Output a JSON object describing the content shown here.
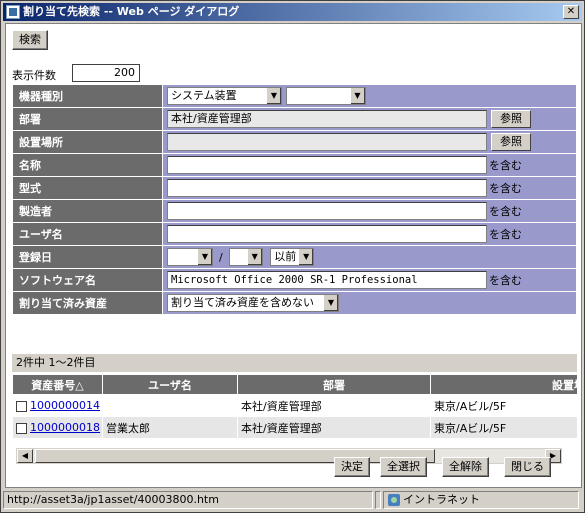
{
  "window": {
    "title": "割り当て先検索 -- Web ページ ダイアログ",
    "close": "✕"
  },
  "toolbar": {
    "search_label": "検索"
  },
  "display_count": {
    "label": "表示件数",
    "value": "200"
  },
  "form": {
    "device_type": {
      "label": "機器種別",
      "selected": "システム装置",
      "selected2": ""
    },
    "department": {
      "label": "部署",
      "value": "本社/資産管理部",
      "ref_label": "参照"
    },
    "location": {
      "label": "設置場所",
      "value": "",
      "ref_label": "参照"
    },
    "name": {
      "label": "名称",
      "value": "",
      "suffix": "を含む"
    },
    "model": {
      "label": "型式",
      "value": "",
      "suffix": "を含む"
    },
    "maker": {
      "label": "製造者",
      "value": "",
      "suffix": "を含む"
    },
    "user_name": {
      "label": "ユーザ名",
      "value": "",
      "suffix": "を含む"
    },
    "reg_date": {
      "label": "登録日",
      "year": "",
      "sep": "/",
      "month": "",
      "cond": "以前"
    },
    "software": {
      "label": "ソフトウェア名",
      "value": "Microsoft Office 2000 SR-1 Professional",
      "suffix": "を含む"
    },
    "assigned": {
      "label": "割り当て済み資産",
      "selected": "割り当て済み資産を含めない"
    }
  },
  "results": {
    "summary": "2件中 1～2件目",
    "columns": [
      "資産番号△",
      "ユーザ名",
      "部署",
      "設置場所"
    ],
    "rows": [
      {
        "asset_no": "1000000014",
        "user": "",
        "department": "本社/資産管理部",
        "location": "東京/Aビル/5F"
      },
      {
        "asset_no": "1000000018",
        "user": "営業太郎",
        "department": "本社/資産管理部",
        "location": "東京/Aビル/5F"
      }
    ]
  },
  "footer": {
    "decide": "決定",
    "select_all": "全選択",
    "clear_all": "全解除",
    "close": "閉じる"
  },
  "status": {
    "url": "http://asset3a/jp1asset/40003800.htm",
    "zone": "イントラネット"
  }
}
